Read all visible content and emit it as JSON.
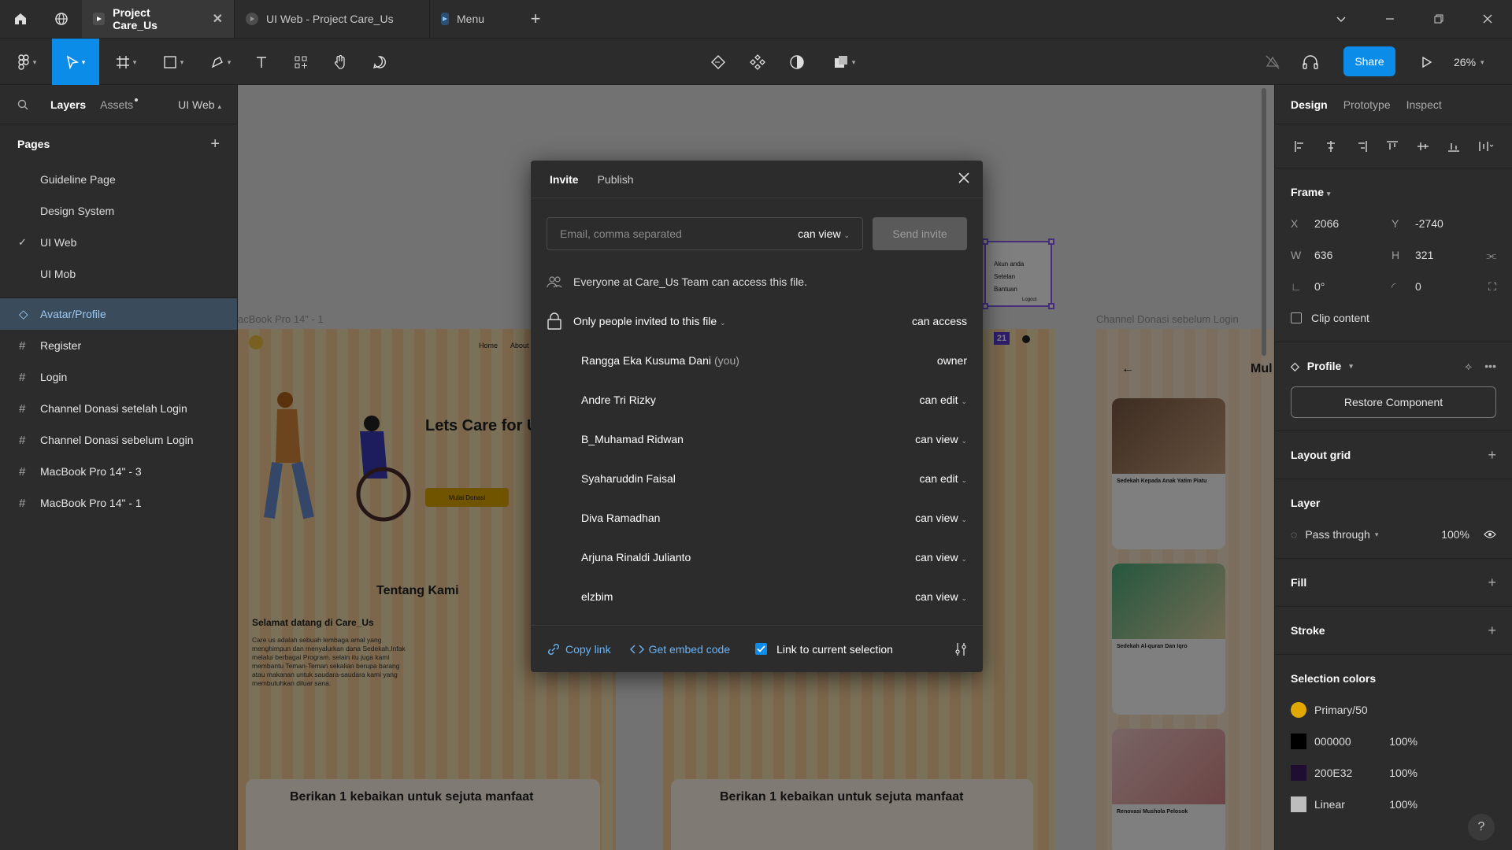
{
  "tabs": [
    {
      "label": "Project Care_Us",
      "active": true
    },
    {
      "label": "UI Web - Project Care_Us",
      "active": false
    },
    {
      "label": "Menu",
      "active": false
    }
  ],
  "toolbar": {
    "share_label": "Share",
    "zoom": "26%"
  },
  "left_panel": {
    "tab_layers": "Layers",
    "tab_assets": "Assets",
    "current_page": "UI Web",
    "pages_title": "Pages",
    "pages": [
      {
        "label": "Guideline Page",
        "checked": false
      },
      {
        "label": "Design System",
        "checked": false
      },
      {
        "label": "UI Web",
        "checked": true
      },
      {
        "label": "UI Mob",
        "checked": false
      }
    ],
    "layers": [
      {
        "label": "Avatar/Profile",
        "icon": "component-icon",
        "selected": true
      },
      {
        "label": "Register",
        "icon": "frame-icon",
        "selected": false
      },
      {
        "label": "Login",
        "icon": "frame-icon",
        "selected": false
      },
      {
        "label": "Channel Donasi setelah Login",
        "icon": "frame-icon",
        "selected": false
      },
      {
        "label": "Channel Donasi sebelum Login",
        "icon": "frame-icon",
        "selected": false
      },
      {
        "label": "MacBook Pro 14\" - 3",
        "icon": "frame-icon",
        "selected": false
      },
      {
        "label": "MacBook Pro 14\" - 1",
        "icon": "frame-icon",
        "selected": false
      }
    ]
  },
  "canvas": {
    "frame_label_1": "acBook Pro 14\" - 1",
    "frame_label_2": "Channel Donasi sebelum Login",
    "hero_title": "Lets Care for U",
    "nav_home": "Home",
    "nav_about": "About",
    "hero_button": "Mulai Donasi",
    "about_title": "Tentang Kami",
    "welcome_title": "Selamat datang di Care_Us",
    "welcome_body": "Care us adalah sebuah lembaga amal yang menghimpun dan menyalurkan dana Sedekah,Infak melalui berbagai Program. selain itu juga kami membantu Teman-Teman sekalian berupa barang atau makanan untuk saudara-saudara kami yang membutuhkan diluar sana.",
    "cta_1": "Berikan 1 kebaikan untuk sejuta manfaat",
    "cta_2": "Berikan 1 kebaikan untuk sejuta manfaat",
    "menu_items": [
      "Akun anda",
      "Setelan",
      "Bantuan"
    ],
    "menu_logout": "Logout",
    "badge_num": "21",
    "mobile_back": "←",
    "mobile_heading": "Mul",
    "mobile_cards": [
      "Sedekah Kepada Anak Yatim Piatu",
      "Sedekah Al-quran Dan Iqro",
      "Renovasi Mushola Pelosok"
    ]
  },
  "modal": {
    "tab_invite": "Invite",
    "tab_publish": "Publish",
    "email_placeholder": "Email, comma separated",
    "invite_permission": "can view",
    "send_label": "Send invite",
    "team_text": "Everyone at Care_Us Team can access this file.",
    "access_label": "Only people invited to this file",
    "access_right": "can access",
    "members": [
      {
        "name": "Rangga Eka Kusuma Dani",
        "you": "(you)",
        "role": "owner",
        "dropdown": false
      },
      {
        "name": "Andre Tri Rizky",
        "you": "",
        "role": "can edit",
        "dropdown": true
      },
      {
        "name": "B_Muhamad Ridwan",
        "you": "",
        "role": "can view",
        "dropdown": true
      },
      {
        "name": "Syaharuddin Faisal",
        "you": "",
        "role": "can edit",
        "dropdown": true
      },
      {
        "name": "Diva Ramadhan",
        "you": "",
        "role": "can view",
        "dropdown": true
      },
      {
        "name": "Arjuna Rinaldi Julianto",
        "you": "",
        "role": "can view",
        "dropdown": true
      },
      {
        "name": "elzbim",
        "you": "",
        "role": "can view",
        "dropdown": true
      }
    ],
    "copy_link": "Copy link",
    "embed_code": "Get embed code",
    "link_selection": "Link to current selection",
    "link_selection_checked": true
  },
  "right_panel": {
    "tab_design": "Design",
    "tab_prototype": "Prototype",
    "tab_inspect": "Inspect",
    "frame_title": "Frame",
    "x": "2066",
    "y": "-2740",
    "w": "636",
    "h": "321",
    "rotation": "0°",
    "radius": "0",
    "clip_content": "Clip content",
    "component_name": "Profile",
    "restore_label": "Restore Component",
    "layout_grid": "Layout grid",
    "layer_title": "Layer",
    "blend_mode": "Pass through",
    "opacity": "100%",
    "fill_title": "Fill",
    "stroke_title": "Stroke",
    "selection_colors_title": "Selection colors",
    "selection_colors": [
      {
        "name": "Primary/50",
        "color": "#e0a800",
        "shape": "circle",
        "pct": ""
      },
      {
        "name": "000000",
        "color": "#000000",
        "shape": "square",
        "pct": "100%"
      },
      {
        "name": "200E32",
        "color": "#200e32",
        "shape": "square",
        "pct": "100%"
      },
      {
        "name": "Linear",
        "color": "#bdbdbd",
        "shape": "square",
        "pct": "100%"
      }
    ]
  },
  "colors": {
    "accent": "#0c8ce9",
    "selection": "#8b5cf6"
  }
}
